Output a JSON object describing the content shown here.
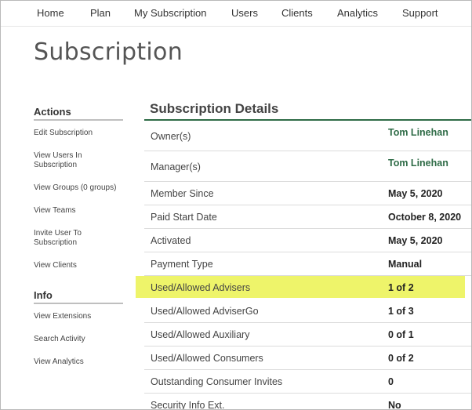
{
  "nav": {
    "items": [
      "Home",
      "Plan",
      "My Subscription",
      "Users",
      "Clients",
      "Analytics",
      "Support"
    ]
  },
  "page": {
    "title": "Subscription"
  },
  "sidebar": {
    "actions_heading": "Actions",
    "actions": [
      "Edit Subscription",
      "View Users In Subscription",
      "View Groups (0 groups)",
      "View Teams",
      "Invite User To Subscription",
      "View Clients"
    ],
    "info_heading": "Info",
    "info": [
      "View Extensions",
      "Search Activity",
      "View Analytics"
    ]
  },
  "details": {
    "title": "Subscription Details",
    "rows": [
      {
        "label": "Owner(s)",
        "value": "Tom Linehan"
      },
      {
        "label": "Manager(s)",
        "value": "Tom Linehan"
      },
      {
        "label": "Member Since",
        "value": "May 5, 2020"
      },
      {
        "label": "Paid Start Date",
        "value": "October 8, 2020"
      },
      {
        "label": "Activated",
        "value": "May 5, 2020"
      },
      {
        "label": "Payment Type",
        "value": "Manual"
      },
      {
        "label": "Used/Allowed Advisers",
        "value": "1 of 2"
      },
      {
        "label": "Used/Allowed AdviserGo",
        "value": "1 of 3"
      },
      {
        "label": "Used/Allowed Auxiliary",
        "value": "0 of 1"
      },
      {
        "label": "Used/Allowed Consumers",
        "value": "0 of 2"
      },
      {
        "label": "Outstanding Consumer Invites",
        "value": "0"
      },
      {
        "label": "Security Info Ext.",
        "value": "No"
      }
    ]
  },
  "colors": {
    "accent_green": "#2e6b46",
    "highlight_yellow": "#eef46a"
  }
}
